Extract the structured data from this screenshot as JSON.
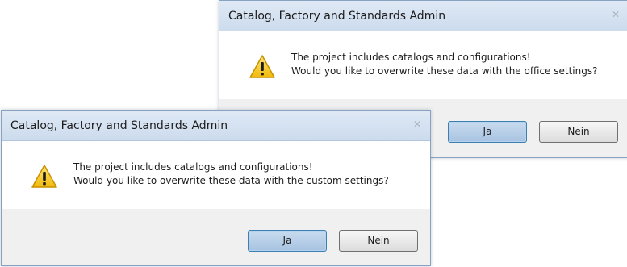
{
  "dialog_back": {
    "title": "Catalog, Factory and Standards Admin",
    "close_glyph": "✕",
    "icon": "warning-icon",
    "message_line1": "The project includes catalogs and configurations!",
    "message_line2": "Would you like to overwrite these data with the office settings?",
    "yes_label": "Ja",
    "no_label": "Nein"
  },
  "dialog_front": {
    "title": "Catalog, Factory and Standards Admin",
    "close_glyph": "✕",
    "icon": "warning-icon",
    "message_line1": "The project includes catalogs and configurations!",
    "message_line2": "Would you like to overwrite these data with the custom settings?",
    "yes_label": "Ja",
    "no_label": "Nein"
  },
  "colors": {
    "titlebar": "#d4e1f0",
    "primary_button": "#b3cbe6",
    "warning_fill": "#f6c828",
    "warning_border": "#c89100"
  }
}
